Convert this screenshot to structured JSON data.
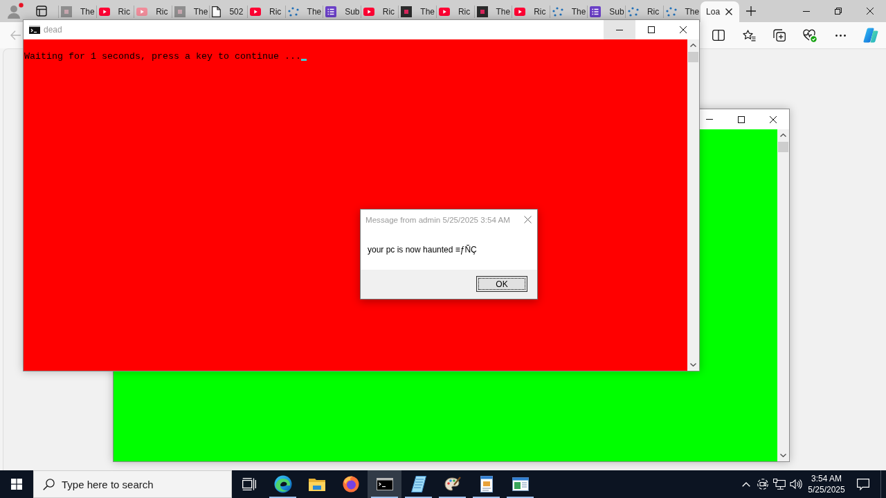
{
  "browser": {
    "tabs": [
      {
        "title": "The",
        "kind": "tile",
        "selected": false
      },
      {
        "title": "Ric",
        "kind": "video",
        "selected": false
      },
      {
        "title": "Ric",
        "kind": "fadedvideo",
        "selected": false
      },
      {
        "title": "The",
        "kind": "tile",
        "selected": false
      },
      {
        "title": "502",
        "kind": "document",
        "selected": false
      },
      {
        "title": "Ric",
        "kind": "video",
        "selected": false
      },
      {
        "title": "The",
        "kind": "dots",
        "selected": false
      },
      {
        "title": "Sub",
        "kind": "list",
        "selected": false
      },
      {
        "title": "Ric",
        "kind": "video",
        "selected": false
      },
      {
        "title": "The",
        "kind": "darktile",
        "selected": false
      },
      {
        "title": "Ric",
        "kind": "video",
        "selected": false
      },
      {
        "title": "The",
        "kind": "darktile",
        "selected": false
      },
      {
        "title": "Ric",
        "kind": "video",
        "selected": false
      },
      {
        "title": "The",
        "kind": "dots",
        "selected": false
      },
      {
        "title": "Sub",
        "kind": "list",
        "selected": false
      },
      {
        "title": "Ric",
        "kind": "dots",
        "selected": false
      },
      {
        "title": "The",
        "kind": "dots",
        "selected": false
      },
      {
        "title": "Loa",
        "kind": "loading",
        "selected": true
      }
    ]
  },
  "console_window": {
    "title": "dead",
    "controls": [
      {
        "kind": "minimize",
        "hovered": true
      },
      {
        "kind": "maximize",
        "hovered": false
      },
      {
        "kind": "close",
        "hovered": false
      }
    ],
    "output": "Waiting for 1 seconds, press a key to continue ..."
  },
  "message_box": {
    "title": "Message from admin 5/25/2025 3:54 AM",
    "message": "your pc is now haunted ≡ƒÑÇ",
    "buttons": [
      "OK"
    ]
  },
  "taskbar": {
    "search": {
      "placeholder": "Type here to search"
    },
    "apps": [
      {
        "kind": "taskview",
        "running": false,
        "selected": false
      },
      {
        "kind": "browser",
        "running": true,
        "selected": false
      },
      {
        "kind": "folder",
        "running": false,
        "selected": false
      },
      {
        "kind": "foxbrowser",
        "running": false,
        "selected": false
      },
      {
        "kind": "terminal",
        "running": true,
        "selected": true
      },
      {
        "kind": "notepad",
        "running": true,
        "selected": false
      },
      {
        "kind": "paint",
        "running": true,
        "selected": false
      },
      {
        "kind": "wordpad",
        "running": true,
        "selected": false
      },
      {
        "kind": "window",
        "running": true,
        "selected": false
      }
    ],
    "clock": {
      "time": "3:54 AM",
      "date": "5/25/2025"
    }
  }
}
